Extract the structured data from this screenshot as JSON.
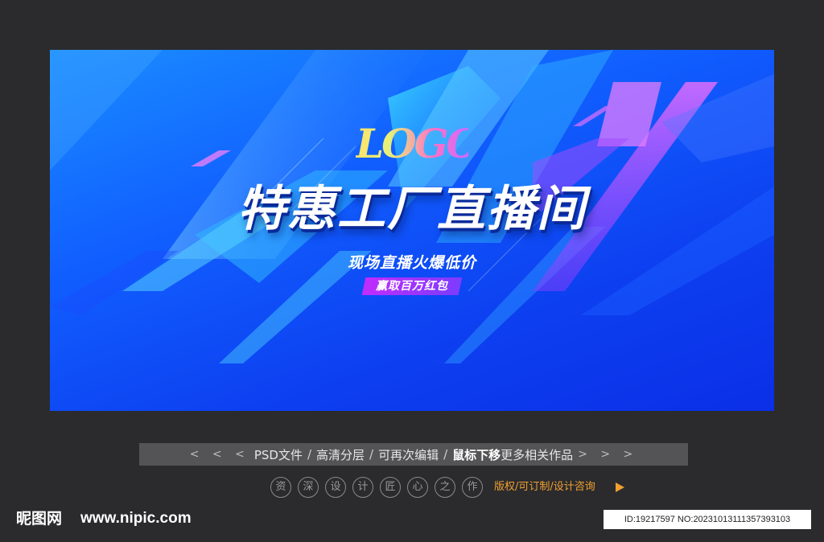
{
  "banner": {
    "logo_text": "LOGO",
    "headline": "特惠工厂直播间",
    "subline": "现场直播火爆低价",
    "tag": "赢取百万红包",
    "colors": {
      "bg_top": "#1a8dff",
      "bg_bottom": "#0b2fe6",
      "accent_purple": "#c02cff",
      "accent_cyan": "#2fd8ff"
    }
  },
  "info_bar": {
    "left_arrows": "< < <",
    "item1": "PSD文件",
    "item2": "高清分层",
    "item3": "可再次编辑",
    "item4_bold": "鼠标下移",
    "item4_rest": "更多相关作品",
    "right_arrows": "> > >",
    "separator": "/"
  },
  "circles": [
    "资",
    "深",
    "设",
    "计",
    "匠",
    "心",
    "之",
    "作"
  ],
  "copyright": "版权/可订制/设计咨询",
  "footer": {
    "site_brand": "昵图网",
    "site_url": "www.nipic.com",
    "id_text": "ID:19217597 NO:20231013111357393103"
  }
}
